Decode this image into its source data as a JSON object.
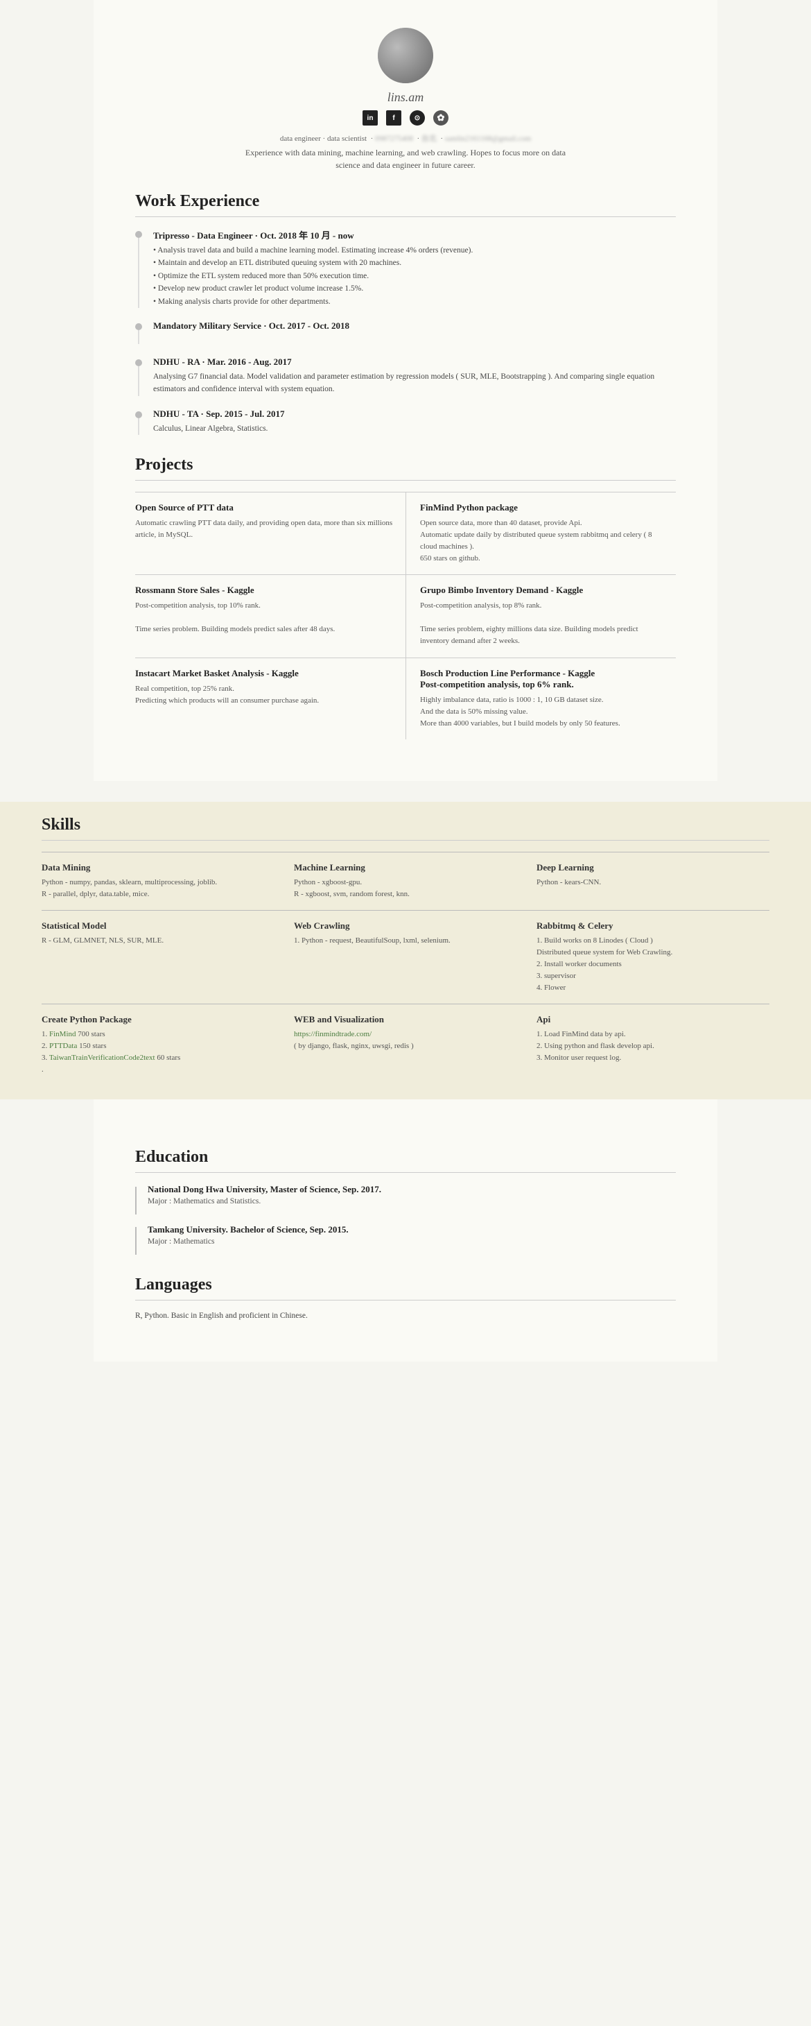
{
  "header": {
    "name": "lins.am",
    "tagline": "Experience with data mining, machine learning, and web crawling. Hopes to focus more on data\nscience and data engineer in future career.",
    "contact": "data engineer · data scientist",
    "social": [
      "in",
      "f",
      "◎",
      "✿"
    ]
  },
  "work_experience": {
    "title": "Work Experience",
    "items": [
      {
        "title": "Tripresso - Data Engineer · Oct. 2018 年 10 月 - now",
        "desc": "• Analysis travel data and build a machine learning model. Estimating increase 4% orders (revenue).\n• Maintain and develop an ETL distributed queuing system with 20 machines.\n• Optimize the ETL system reduced more than 50% execution time.\n• Develop new product crawler let product volume increase 1.5%.\n• Making analysis charts provide for other departments."
      },
      {
        "title": "Mandatory Military Service · Oct. 2017 - Oct. 2018",
        "desc": ""
      },
      {
        "title": "NDHU - RA · Mar. 2016 - Aug. 2017",
        "desc": "Analysing G7 financial data. Model validation and parameter estimation by regression models ( SUR, MLE, Bootstrapping ). And comparing single equation estimators and confidence interval with system equation."
      },
      {
        "title": "NDHU - TA · Sep. 2015 - Jul. 2017",
        "desc": "Calculus, Linear Algebra, Statistics."
      }
    ]
  },
  "projects": {
    "title": "Projects",
    "items": [
      {
        "name": "Open Source of PTT data",
        "desc": "Automatic crawling PTT data daily, and providing open data, more than six millions article, in MySQL."
      },
      {
        "name": "FinMind Python package",
        "desc": "Open source data, more than 40 dataset, provide Api.\nAutomatic update daily by distributed queue system rabbitmq and celery ( 8 cloud machines ).\n650 stars on github."
      },
      {
        "name": "Rossmann Store Sales - Kaggle",
        "desc": "Post-competition analysis, top 10% rank.\n\nTime series problem. Building models predict sales after 48 days."
      },
      {
        "name": "Grupo Bimbo Inventory Demand - Kaggle",
        "desc": "Post-competition analysis, top 8% rank.\n\nTime series problem, eighty millions data size. Building models predict inventory demand after 2 weeks."
      },
      {
        "name": "Instacart Market Basket Analysis - Kaggle",
        "desc": "Real competition, top 25% rank.\nPredicting which products will an consumer purchase again."
      },
      {
        "name": "Bosch Production Line Performance - Kaggle Post-competition analysis, top 6% rank.",
        "desc": "Highly imbalance data, ratio is 1000 : 1, 10 GB dataset size.\nAnd the data is 50% missing value.\nMore than 4000 variables, but I build models by only 50 features."
      }
    ]
  },
  "skills": {
    "title": "Skills",
    "items": [
      {
        "name": "Data Mining",
        "desc": "Python - numpy, pandas, sklearn, multiprocessing, joblib.\nR - parallel, dplyr, data.table, mice."
      },
      {
        "name": "Machine Learning",
        "desc": "Python - xgboost-gpu.\nR - xgboost, svm, random forest, knn."
      },
      {
        "name": "Deep Learning",
        "desc": "Python - kears-CNN."
      },
      {
        "name": "Statistical Model",
        "desc": "R - GLM, GLMNET, NLS, SUR, MLE."
      },
      {
        "name": "Web Crawling",
        "desc": "1. Python - request, BeautifulSoup, lxml, selenium."
      },
      {
        "name": "Rabbitmq & Celery",
        "desc": "1. Build works on 8 Linodes ( Cloud )\nDistributed queue system for Web Crawling.\n2. Install worker documents\n3. supervisor\n4. Flower"
      },
      {
        "name": "Create Python Package",
        "desc": "1. FinMind 700 stars\n2. PTTData 150 stars\n3. TaiwanTrainVerificationCode2text 60 stars\n."
      },
      {
        "name": "WEB and Visualization",
        "url": "https://finmindtrade.com/",
        "desc": "( by django, flask, nginx, uwsgi, redis )"
      },
      {
        "name": "Api",
        "desc": "1. Load FinMind data by api.\n2. Using python and flask develop api.\n3. Monitor user request log."
      }
    ]
  },
  "education": {
    "title": "Education",
    "items": [
      {
        "title": "National Dong Hwa University, Master of Science,  Sep. 2017.",
        "desc": "Major : Mathematics and Statistics."
      },
      {
        "title": "Tamkang University. Bachelor of Science, Sep. 2015.",
        "desc": "Major : Mathematics"
      }
    ]
  },
  "languages": {
    "title": "Languages",
    "desc": "R, Python. Basic in English and proficient in Chinese."
  }
}
